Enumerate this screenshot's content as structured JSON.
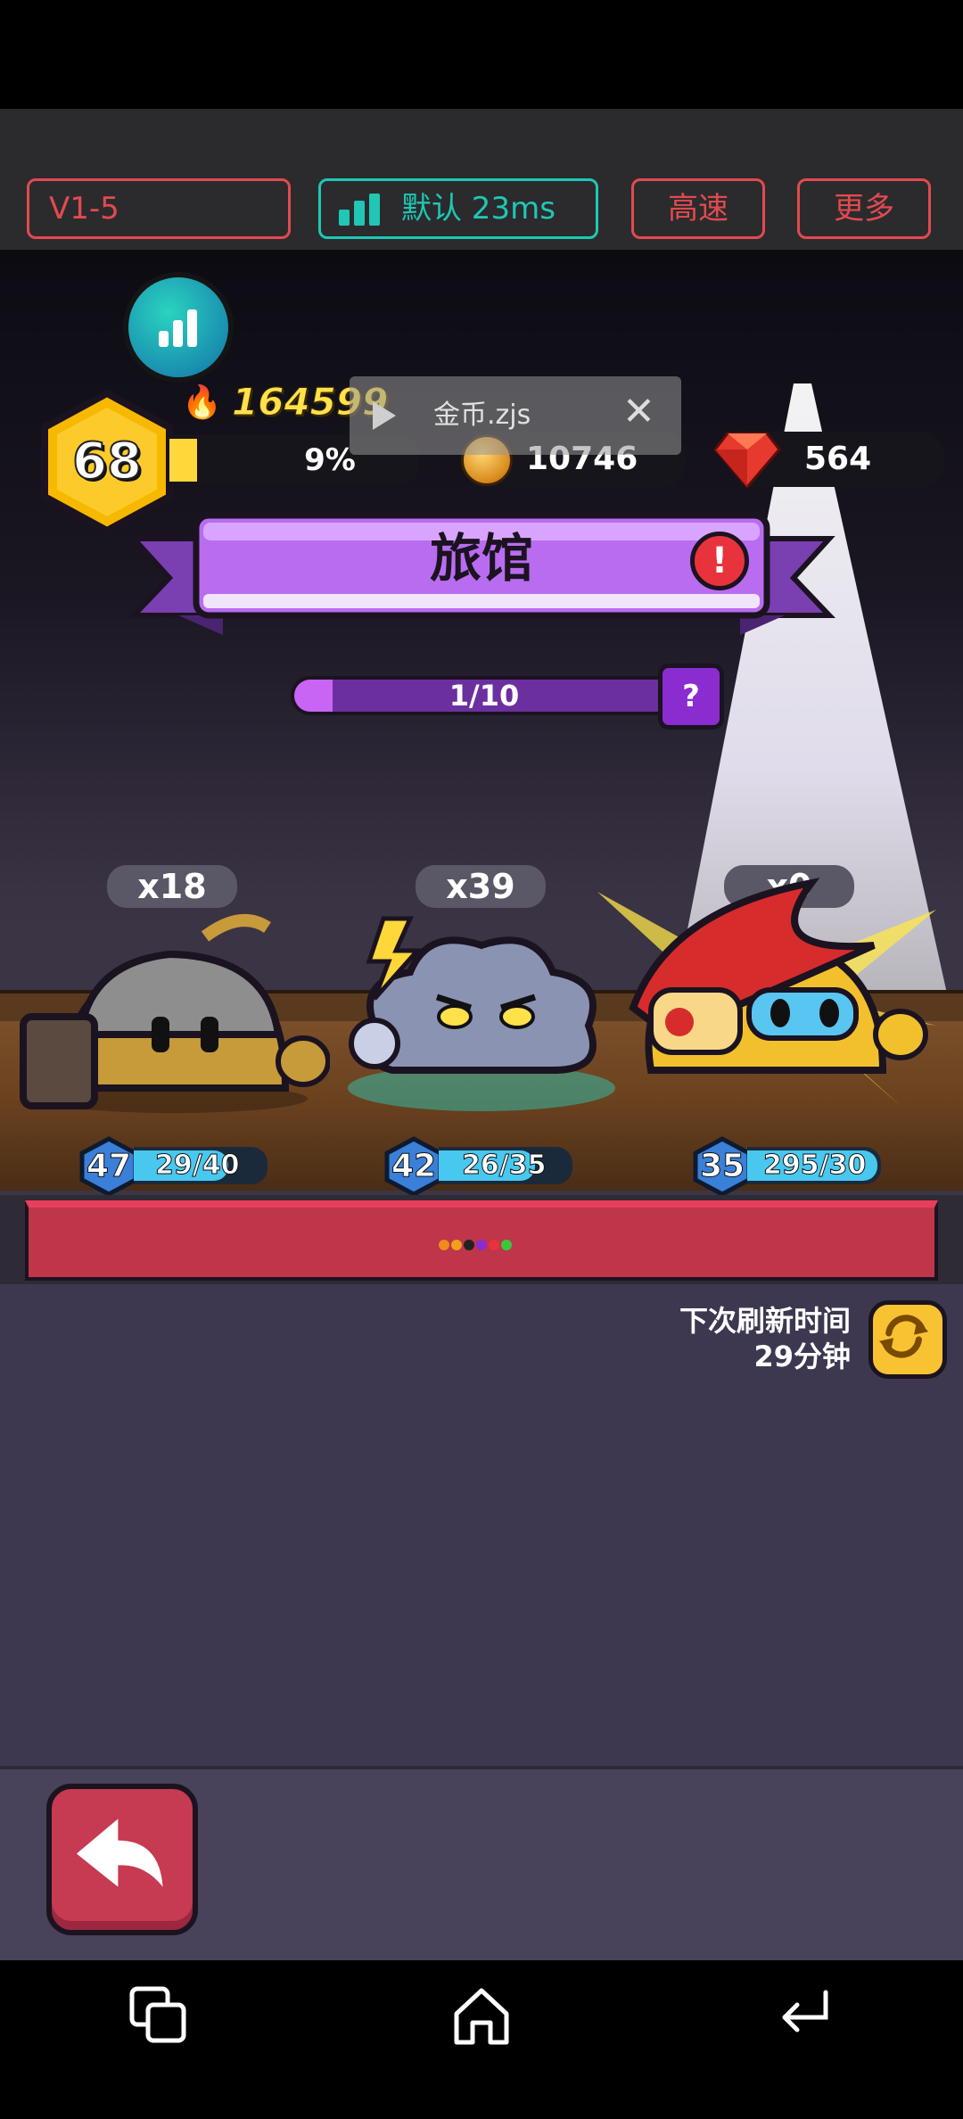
{
  "toolbar": {
    "version_label": "V1-5",
    "ping_label": "默认 23ms",
    "speed_label": "高速",
    "more_label": "更多",
    "accent_red": "#e24a4f",
    "accent_teal": "#1fc7b4"
  },
  "hud": {
    "player_level": "68",
    "combat_power": "164599",
    "xp_percent_label": "9%",
    "xp_fraction": 0.09,
    "coins": "10746",
    "gems": "564"
  },
  "toast": {
    "script_name": "金币.zjs"
  },
  "location": {
    "title": "旅馆",
    "progress_label": "1/10",
    "progress_fraction": 0.1,
    "help_label": "?"
  },
  "units": [
    {
      "count": "x18",
      "level": "47",
      "hp": "29/40",
      "hp_fraction": 0.725
    },
    {
      "count": "x39",
      "level": "42",
      "hp": "26/35",
      "hp_fraction": 0.743
    },
    {
      "count": "x0",
      "level": "35",
      "hp": "295/30",
      "hp_fraction": 1.0
    }
  ],
  "refresh": {
    "label": "下次刷新时间",
    "time": "29分钟"
  },
  "icons": {
    "stats": "bar-chart-icon",
    "fire": "fire-icon",
    "coin": "coin-icon",
    "gem": "gem-icon",
    "alert": "exclamation-icon",
    "refresh": "refresh-icon",
    "back": "back-arrow-icon",
    "recents": "recents-icon",
    "home": "home-icon",
    "nav_back": "nav-back-icon"
  }
}
